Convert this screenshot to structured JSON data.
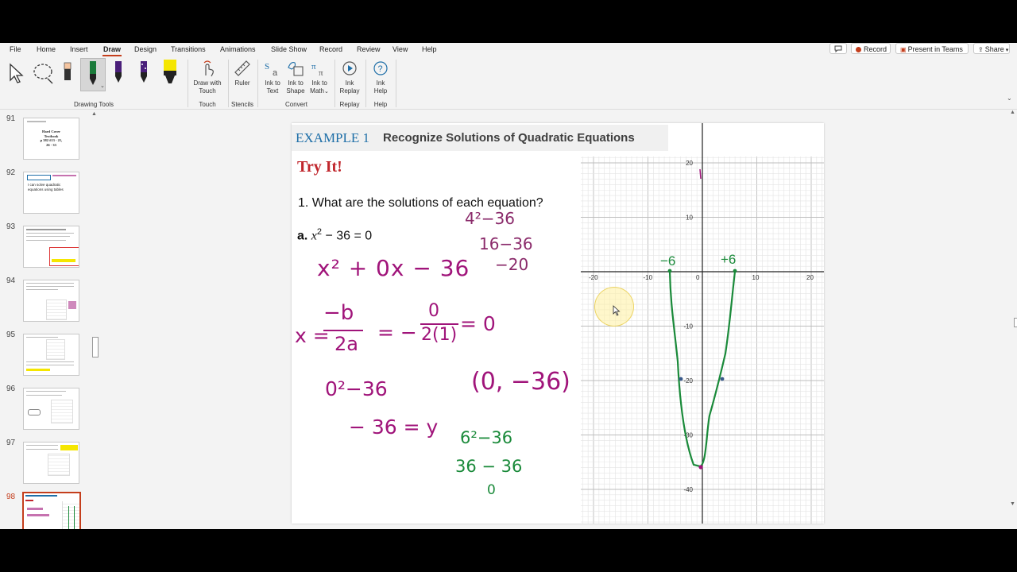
{
  "menu": {
    "tabs": [
      "File",
      "Home",
      "Insert",
      "Draw",
      "Design",
      "Transitions",
      "Animations",
      "Slide Show",
      "Record",
      "Review",
      "View",
      "Help"
    ],
    "active_tab": "Draw",
    "record_label": "Record",
    "present_label": "Present in Teams",
    "share_label": "Share"
  },
  "ribbon": {
    "groups": {
      "drawing_tools": "Drawing Tools",
      "touch": "Touch",
      "stencils": "Stencils",
      "convert": "Convert",
      "replay": "Replay",
      "help": "Help"
    },
    "buttons": {
      "draw_with_touch_1": "Draw with",
      "draw_with_touch_2": "Touch",
      "ruler": "Ruler",
      "ink_to_text_1": "Ink to",
      "ink_to_text_2": "Text",
      "ink_to_shape_1": "Ink to",
      "ink_to_shape_2": "Shape",
      "ink_to_math_1": "Ink to",
      "ink_to_math_2": "Math",
      "ink_replay_1": "Ink",
      "ink_replay_2": "Replay",
      "ink_help_1": "Ink",
      "ink_help_2": "Help"
    },
    "pen_colors": [
      "#2b2b2b",
      "#1a7a3a",
      "#4a1f7a",
      "#4a1f7a",
      "#f5e600"
    ]
  },
  "thumbnails": {
    "numbers": [
      "91",
      "92",
      "93",
      "94",
      "95",
      "96",
      "97",
      "98"
    ],
    "selected": "98",
    "t91_lines": [
      "Hard Cover",
      "Textbook",
      "p 382 #13 - 21,",
      "26 - 33"
    ],
    "t92_lines": [
      "I can solve quadratic",
      "equations using tables"
    ]
  },
  "slide": {
    "example_label": "EXAMPLE 1",
    "example_title": "Recognize Solutions of Quadratic Equations",
    "try_it": "Try It!",
    "question": "1. What are the solutions of each equation?",
    "part_a": "a.",
    "graph": {
      "x_ticks": [
        "-20",
        "-10",
        "0",
        "10",
        "20"
      ],
      "y_ticks": [
        "20",
        "10",
        "-10",
        "-20",
        "-30",
        "-40"
      ]
    },
    "ink": {
      "line1": "x² + 0x − 36",
      "x_eq": "x =",
      "minus_b": "−b",
      "two_a": "2a",
      "eq_minus": "= −",
      "zero_num": "0",
      "two_1": "2(1)",
      "eq_zero": "= 0",
      "zero_sq": "0²−36",
      "neg36": "− 36 = y",
      "vertex": "(0, −36)",
      "c1": "4²−36",
      "c2": "16−36",
      "c3": "−20",
      "g1": "6²−36",
      "g2": "36 − 36",
      "g3": "0",
      "left_root": "−6",
      "right_root": "+6"
    }
  },
  "colors": {
    "accent": "#c43e1c",
    "ink_purple": "#a0147a",
    "ink_green": "#1a8a3a",
    "title_blue": "#1f6fa8",
    "try_red": "#c0262c"
  }
}
